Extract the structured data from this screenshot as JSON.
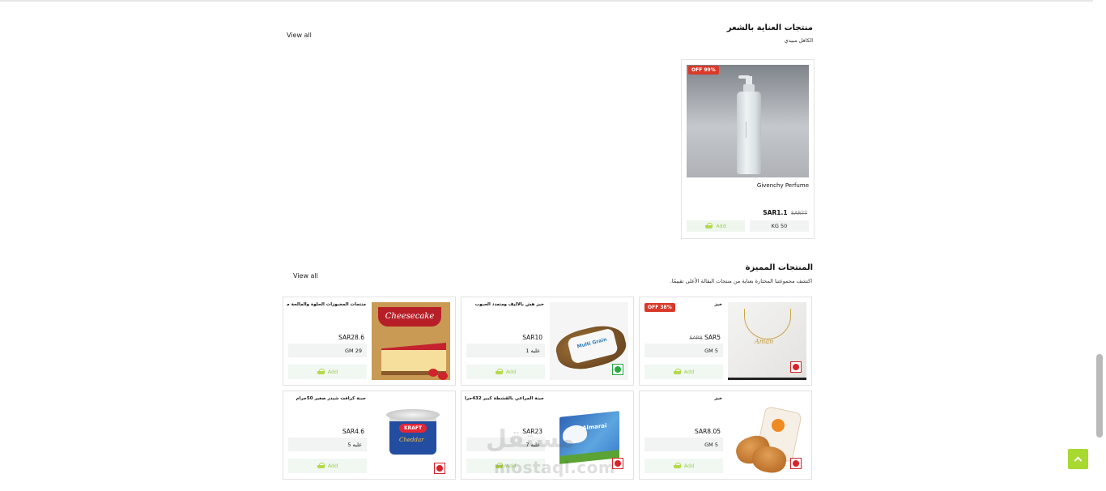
{
  "hair_section": {
    "title": "منتجات العناية بالشعر",
    "subtitle": "الكافل مبيدي",
    "view_all": "View all",
    "product": {
      "discount": "OFF 99%",
      "name": "Givenchy Perfume",
      "price": "SAR1.1",
      "old_price": "SAR77",
      "unit": "KG 50",
      "add_label": "Add"
    }
  },
  "featured_section": {
    "title": "المنتجات المميزة",
    "subtitle": "اكتشف مجموعتنا المختارة بعناية من منتجات البقالة الأعلى تقييمًا.",
    "view_all": "View all",
    "products": [
      {
        "name": "خبز",
        "discount": "OFF 38%",
        "price": "SAR5",
        "old_price": "SAR8",
        "unit": "GM 5",
        "add_label": "Add",
        "indicator": "red",
        "image": "necklace-image"
      },
      {
        "name": "خبز هش بالأليف ومتعدد الحبوب",
        "price": "SAR10",
        "unit": "1 علبه",
        "add_label": "Add",
        "indicator": "green",
        "image": "multigrain-bread-image"
      },
      {
        "name": "منتجات المخبوزات الحلوة والمالحة من",
        "price": "SAR28.6",
        "unit": "GM 29",
        "add_label": "Add",
        "indicator": "none",
        "image": "cheesecake-image"
      },
      {
        "name": "خبز",
        "price": "SAR8.05",
        "unit": "GM 5",
        "add_label": "Add",
        "indicator": "red",
        "image": "bread-bag-image"
      },
      {
        "name": "جبنة المراعي بالقشطة كبير 432جرام",
        "price": "SAR23",
        "unit": "7 علبه",
        "add_label": "Add",
        "indicator": "red",
        "image": "almarai-cheese-image"
      },
      {
        "name": "جبنة كرافت شيدر صغير 50جرام",
        "price": "SAR4.6",
        "unit": "5 علبه",
        "add_label": "Add",
        "indicator": "red",
        "image": "kraft-cheese-image"
      }
    ]
  },
  "image_text": {
    "cheesecake": "Cheesecake",
    "bread_label": "Multi Grain",
    "almarai": "Almarai",
    "kraft_logo": "KRAFT",
    "kraft_text": "Cheddar"
  },
  "watermark": {
    "arabic": "مستقل",
    "english": "mostaql.com"
  },
  "colors": {
    "accent": "#a7d930",
    "badge": "#d93a2b",
    "veg_green": "#27a844",
    "nonveg_red": "#d6242a"
  }
}
